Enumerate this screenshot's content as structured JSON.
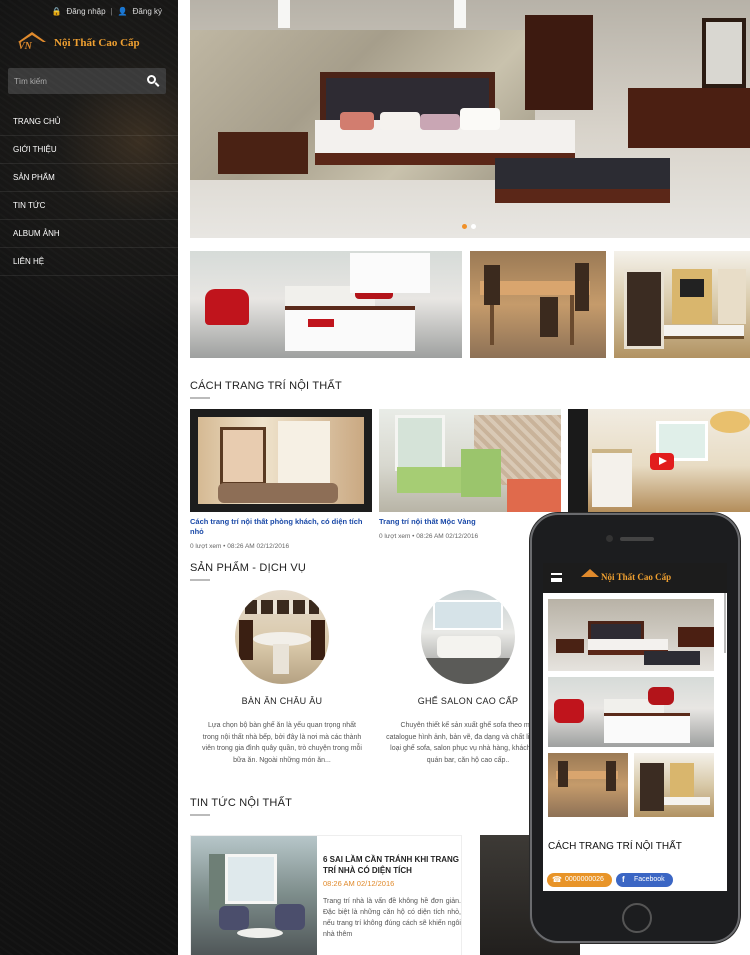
{
  "header": {
    "login": "Đăng nhập",
    "separator": "|",
    "register": "Đăng ký"
  },
  "brand": {
    "logo_mark": "VN",
    "name": "Nội Thất Cao Cấp"
  },
  "search": {
    "placeholder": "Tìm kiếm"
  },
  "menu": [
    "TRANG CHỦ",
    "GIỚI THIỆU",
    "SẢN PHẨM",
    "TIN TỨC",
    "ALBUM ẢNH",
    "LIÊN HỆ"
  ],
  "sections": {
    "decor": "CÁCH TRANG TRÍ NỘI THẤT",
    "products": "SẢN PHẨM - DỊCH VỤ",
    "news": "TIN TỨC NỘI THẤT"
  },
  "posts": [
    {
      "title": "Cách trang trí nội thất phòng khách, có diện tích nhỏ",
      "meta": "0 lượt xem  •  08:26 AM 02/12/2016"
    },
    {
      "title": "Trang trí nội thất Mộc Vàng",
      "meta": "0 lượt xem  •  08:26 AM 02/12/2016"
    }
  ],
  "products": [
    {
      "name": "BÀN ĂN CHÂU ÂU",
      "desc": "Lựa chọn bộ bàn ghế ăn là yếu quan trọng nhất trong nội thất nhà bếp, bởi đây là nơi mà các thành viên trong gia đình quây quần, trò chuyện trong mỗi bữa ăn. Ngoài những món ăn..."
    },
    {
      "name": "GHẾ SALON CAO CẤP",
      "desc": "Chuyên thiết kế sản xuất ghế sofa theo mã, catalogue hình ảnh, bản vẽ, đa dạng và chất liệu các loại ghế sofa, salon phục vụ nhà hàng, khách sạn, quán bar, căn hộ cao cấp.."
    }
  ],
  "news": {
    "title": "6 SAI LẦM CẦN TRÁNH KHI TRANG TRÍ NHÀ CÓ DIỆN TÍCH",
    "date": "08:26 AM 02/12/2016",
    "excerpt": "Trang trí nhà là vấn đề không hề đơn giản. Đặc biệt là những căn hộ có diện tích nhỏ, nếu trang trí không đúng cách sẽ khiến ngôi nhà thêm"
  },
  "phone": {
    "brand": "Nội Thất Cao Cấp",
    "section": "CÁCH TRANG TRÍ NỘI THẤT",
    "call": "0000000026",
    "facebook": "Facebook"
  },
  "colors": {
    "accent": "#e08a2c",
    "link": "#1b4aa8",
    "sidebar": "#141414",
    "facebook": "#3b66c4"
  }
}
